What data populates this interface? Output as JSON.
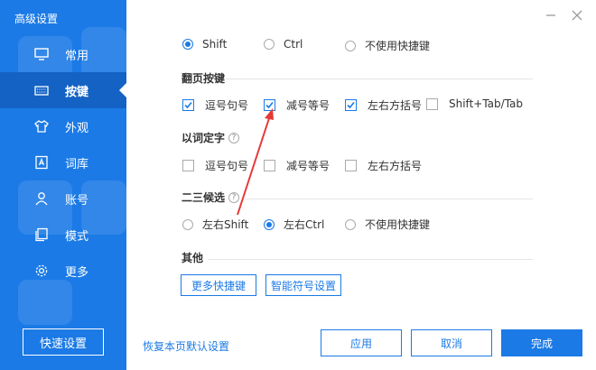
{
  "sidebar": {
    "title": "高级设置",
    "items": [
      {
        "label": "常用",
        "icon": "monitor-icon"
      },
      {
        "label": "按键",
        "icon": "keyboard-icon",
        "active": true
      },
      {
        "label": "外观",
        "icon": "shirt-icon"
      },
      {
        "label": "词库",
        "icon": "dictionary-icon"
      },
      {
        "label": "账号",
        "icon": "user-icon"
      },
      {
        "label": "模式",
        "icon": "mode-icon"
      },
      {
        "label": "更多",
        "icon": "gear-icon"
      }
    ],
    "quick_button": "快速设置"
  },
  "window_controls": {
    "minimize": "minimize-icon",
    "close": "close-icon"
  },
  "shift_row": {
    "options": [
      {
        "label": "Shift",
        "selected": true
      },
      {
        "label": "Ctrl",
        "selected": false
      },
      {
        "label": "不使用快捷键",
        "selected": false
      }
    ]
  },
  "page_turn": {
    "title": "翻页按键",
    "options": [
      {
        "label": "逗号句号",
        "checked": true
      },
      {
        "label": "减号等号",
        "checked": true
      },
      {
        "label": "左右方括号",
        "checked": true
      },
      {
        "label": "Shift+Tab/Tab",
        "checked": false
      }
    ]
  },
  "word_select": {
    "title": "以词定字",
    "options": [
      {
        "label": "逗号句号",
        "checked": false
      },
      {
        "label": "减号等号",
        "checked": false
      },
      {
        "label": "左右方括号",
        "checked": false
      }
    ]
  },
  "candidates": {
    "title": "二三候选",
    "options": [
      {
        "label": "左右Shift",
        "selected": false
      },
      {
        "label": "左右Ctrl",
        "selected": true
      },
      {
        "label": "不使用快捷键",
        "selected": false
      }
    ]
  },
  "other": {
    "title": "其他",
    "more_shortcuts": "更多快捷键",
    "smart_symbol": "智能符号设置"
  },
  "footer": {
    "restore": "恢复本页默认设置",
    "apply": "应用",
    "cancel": "取消",
    "done": "完成"
  },
  "help_glyph": "?",
  "colors": {
    "accent": "#1b7ae6",
    "sidebar": "#1b7ae6",
    "active": "#1462c4",
    "annotation": "#e53935"
  }
}
